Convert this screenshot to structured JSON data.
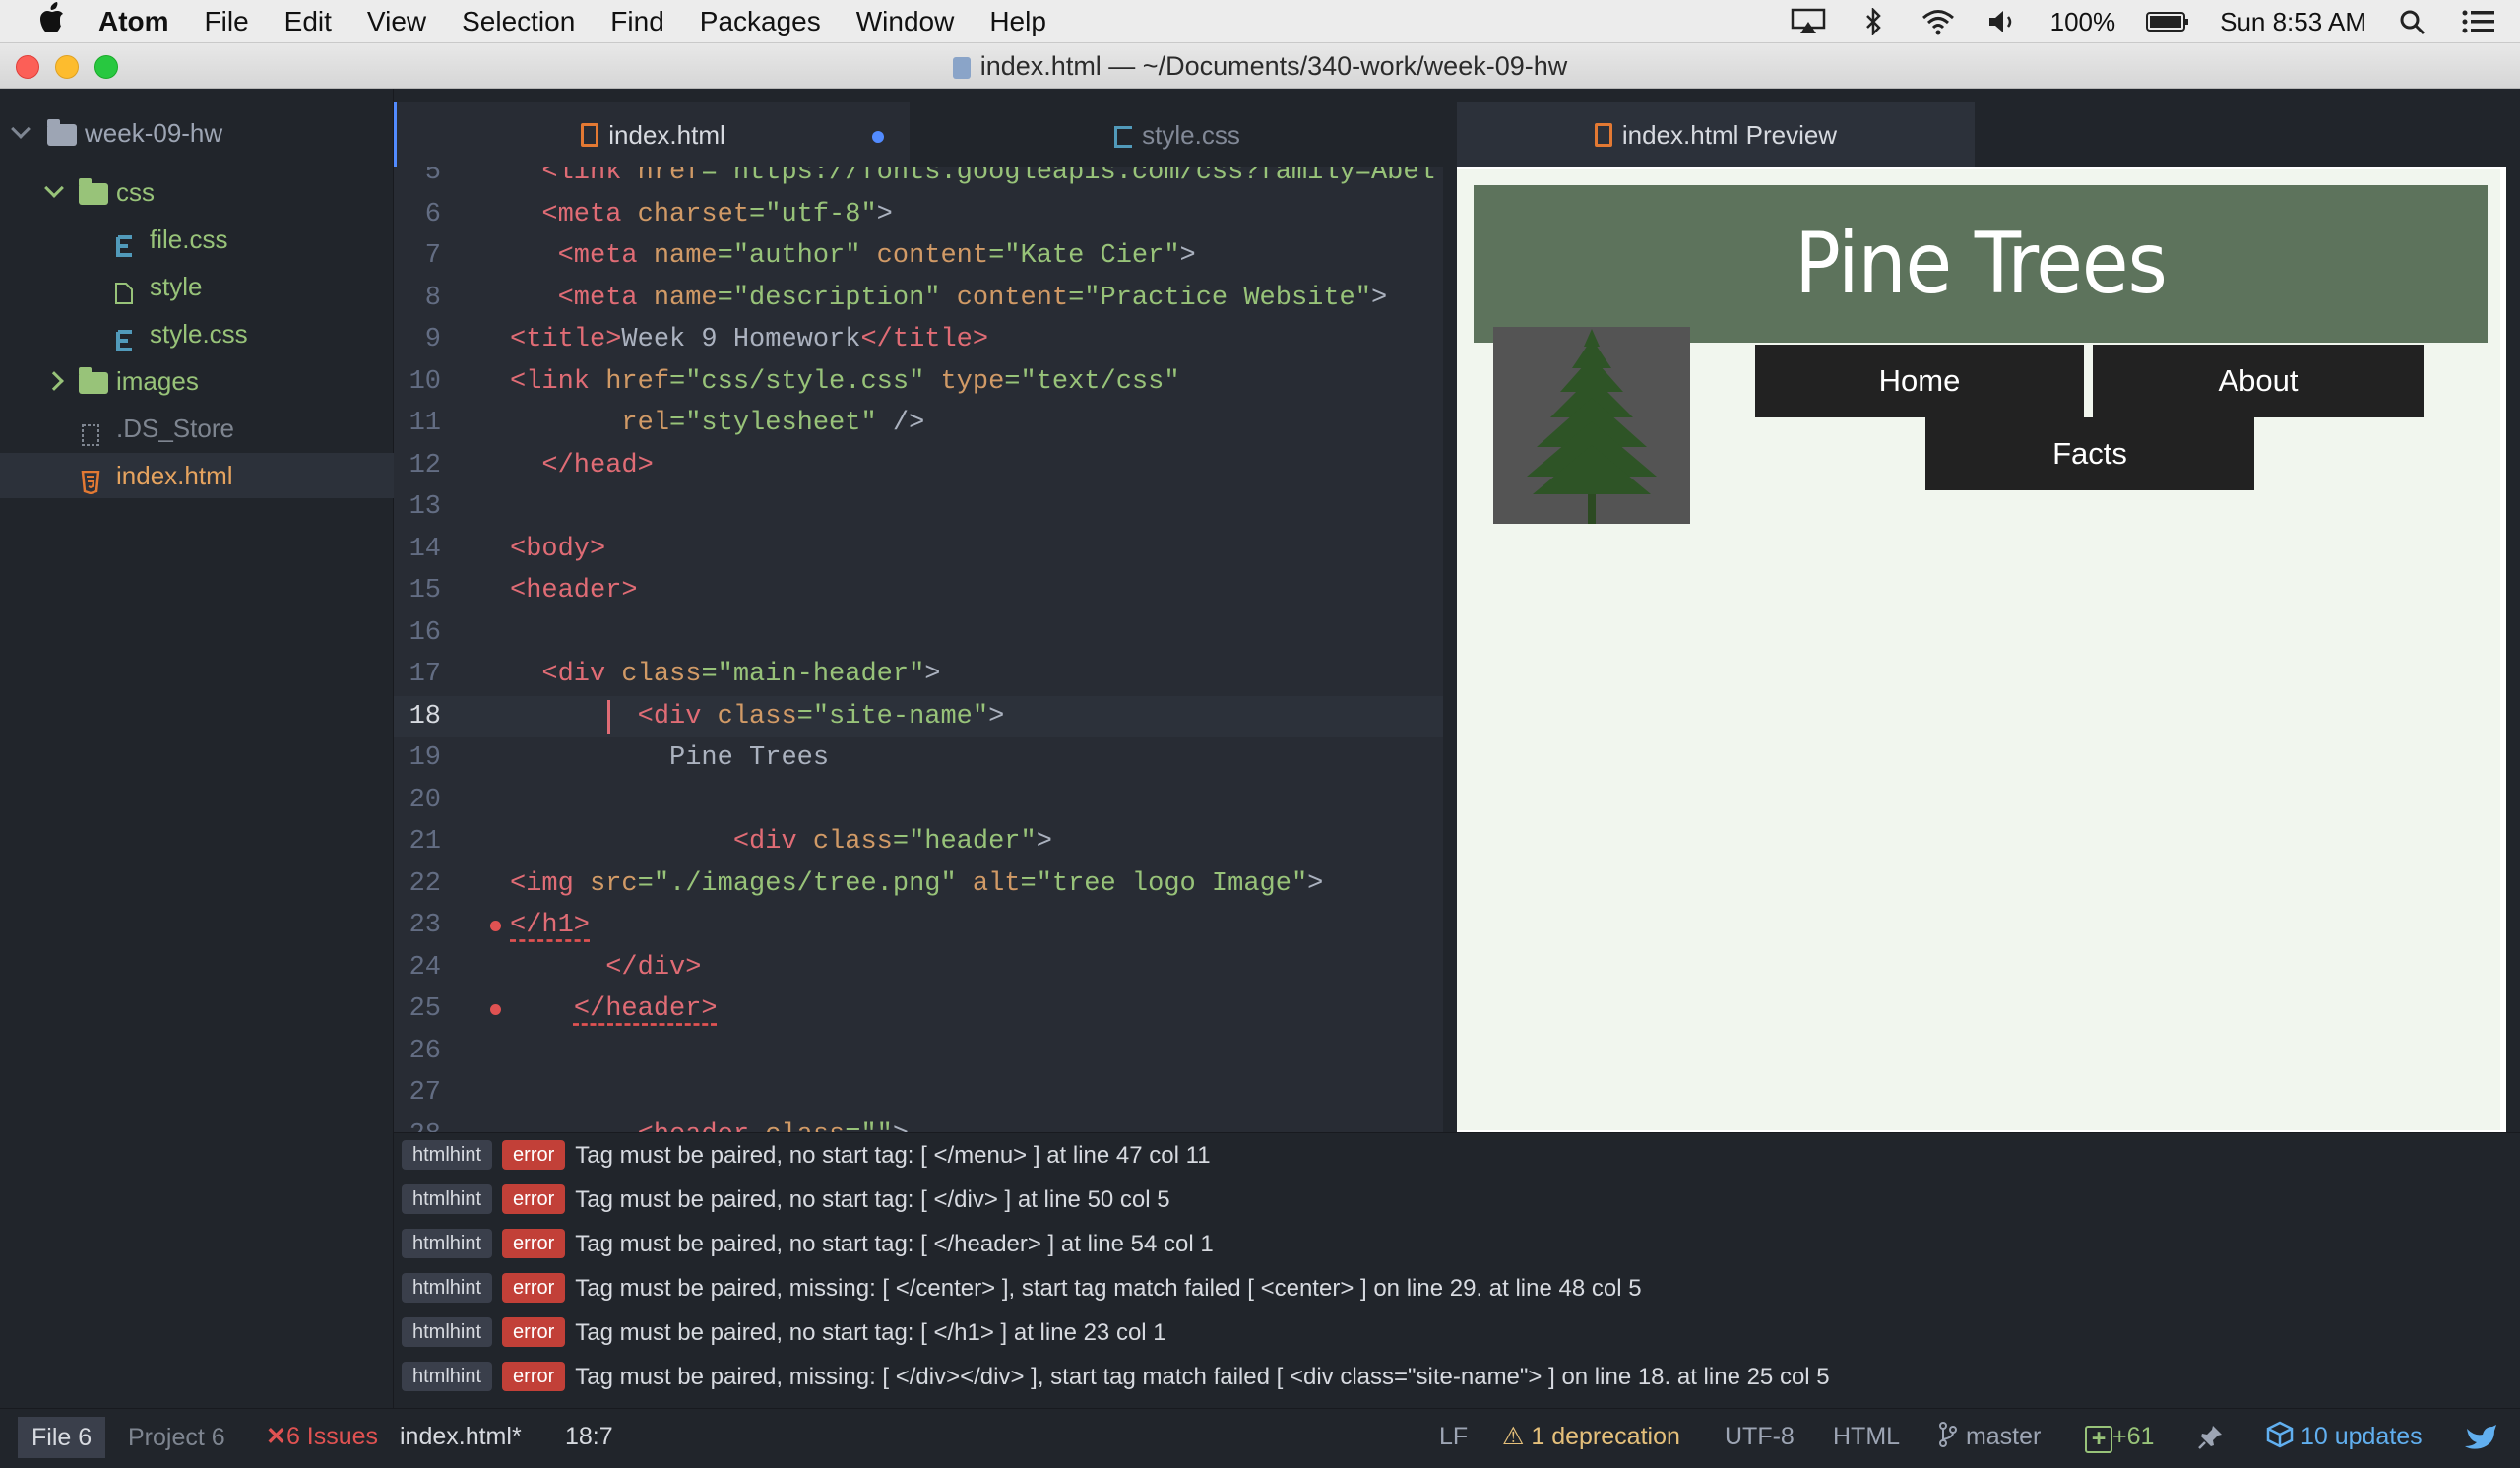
{
  "menubar": {
    "items": [
      "Atom",
      "File",
      "Edit",
      "View",
      "Selection",
      "Find",
      "Packages",
      "Window",
      "Help"
    ],
    "battery": "100%",
    "clock": "Sun 8:53 AM"
  },
  "window": {
    "title": "index.html — ~/Documents/340-work/week-09-hw"
  },
  "tree": {
    "root": "week-09-hw",
    "items": [
      {
        "label": "css",
        "kind": "folder",
        "expanded": true
      },
      {
        "label": "file.css",
        "kind": "css"
      },
      {
        "label": "style",
        "kind": "file"
      },
      {
        "label": "style.css",
        "kind": "css"
      },
      {
        "label": "images",
        "kind": "folder",
        "expanded": false
      },
      {
        "label": ".DS_Store",
        "kind": "file"
      },
      {
        "label": "index.html",
        "kind": "html",
        "selected": true
      }
    ]
  },
  "tabs": [
    {
      "label": "index.html",
      "active": true,
      "modified": true
    },
    {
      "label": "style.css",
      "active": false
    },
    {
      "label": "index.html Preview",
      "active": false
    }
  ],
  "editor": {
    "cursor_line": "18",
    "lines": [
      {
        "n": "5",
        "segs": [
          [
            "  ",
            "txt"
          ],
          [
            "<link ",
            "tag"
          ],
          [
            "href",
            "attr"
          ],
          [
            "=\"https://fonts.googleapis.com/css?family=Abel",
            "str"
          ]
        ]
      },
      {
        "n": "6",
        "segs": [
          [
            "  ",
            "txt"
          ],
          [
            "<meta ",
            "tag"
          ],
          [
            "charset",
            "attr"
          ],
          [
            "=\"utf-8\"",
            "str"
          ],
          [
            ">",
            "txt"
          ]
        ]
      },
      {
        "n": "7",
        "segs": [
          [
            "   ",
            "txt"
          ],
          [
            "<meta ",
            "tag"
          ],
          [
            "name",
            "attr"
          ],
          [
            "=\"author\" ",
            "str"
          ],
          [
            "content",
            "attr"
          ],
          [
            "=\"Kate Cier\"",
            "str"
          ],
          [
            ">",
            "txt"
          ]
        ]
      },
      {
        "n": "8",
        "segs": [
          [
            "   ",
            "txt"
          ],
          [
            "<meta ",
            "tag"
          ],
          [
            "name",
            "attr"
          ],
          [
            "=\"description\" ",
            "str"
          ],
          [
            "content",
            "attr"
          ],
          [
            "=\"Practice Website\"",
            "str"
          ],
          [
            ">",
            "txt"
          ]
        ]
      },
      {
        "n": "9",
        "segs": [
          [
            "<title>",
            "tag"
          ],
          [
            "Week 9 Homework",
            "txt"
          ],
          [
            "</title>",
            "tag"
          ]
        ]
      },
      {
        "n": "10",
        "segs": [
          [
            "<link ",
            "tag"
          ],
          [
            "href",
            "attr"
          ],
          [
            "=\"css/style.css\" ",
            "str"
          ],
          [
            "type",
            "attr"
          ],
          [
            "=\"text/css\"",
            "str"
          ]
        ]
      },
      {
        "n": "11",
        "segs": [
          [
            "       ",
            "txt"
          ],
          [
            "rel",
            "attr"
          ],
          [
            "=\"stylesheet\"",
            "str"
          ],
          [
            " />",
            "txt"
          ]
        ]
      },
      {
        "n": "12",
        "segs": [
          [
            "  ",
            "txt"
          ],
          [
            "</head>",
            "tag"
          ]
        ]
      },
      {
        "n": "13",
        "segs": []
      },
      {
        "n": "14",
        "segs": [
          [
            "<body>",
            "tag"
          ]
        ]
      },
      {
        "n": "15",
        "segs": [
          [
            "<header>",
            "tag"
          ]
        ]
      },
      {
        "n": "16",
        "segs": []
      },
      {
        "n": "17",
        "segs": [
          [
            "  ",
            "txt"
          ],
          [
            "<div ",
            "tag"
          ],
          [
            "class",
            "attr"
          ],
          [
            "=\"main-header\"",
            "str"
          ],
          [
            ">",
            "txt"
          ]
        ]
      },
      {
        "n": "18",
        "segs": [
          [
            "        ",
            "txt"
          ],
          [
            "<div ",
            "tag"
          ],
          [
            "class",
            "attr"
          ],
          [
            "=\"site-name\"",
            "str"
          ],
          [
            ">",
            "txt"
          ]
        ]
      },
      {
        "n": "19",
        "segs": [
          [
            "          ",
            "txt"
          ],
          [
            "Pine Trees",
            "txt"
          ]
        ]
      },
      {
        "n": "20",
        "segs": []
      },
      {
        "n": "21",
        "segs": [
          [
            "              ",
            "txt"
          ],
          [
            "<div ",
            "tag"
          ],
          [
            "class",
            "attr"
          ],
          [
            "=\"header\"",
            "str"
          ],
          [
            ">",
            "txt"
          ]
        ]
      },
      {
        "n": "22",
        "segs": [
          [
            "<img ",
            "tag"
          ],
          [
            "src",
            "attr"
          ],
          [
            "=\"./images/tree.png\" ",
            "str"
          ],
          [
            "alt",
            "attr"
          ],
          [
            "=\"tree logo Image\"",
            "str"
          ],
          [
            ">",
            "txt"
          ]
        ]
      },
      {
        "n": "23",
        "error": true,
        "segs": [
          [
            "</h1>",
            "tag-err"
          ]
        ]
      },
      {
        "n": "24",
        "segs": [
          [
            "      ",
            "txt"
          ],
          [
            "</div>",
            "tag"
          ]
        ]
      },
      {
        "n": "25",
        "error": true,
        "segs": [
          [
            "    ",
            "txt"
          ],
          [
            "</header>",
            "tag-err"
          ]
        ]
      },
      {
        "n": "26",
        "segs": []
      },
      {
        "n": "27",
        "segs": []
      },
      {
        "n": "28",
        "segs": [
          [
            "        ",
            "txt"
          ],
          [
            "<header ",
            "tag"
          ],
          [
            "class",
            "attr"
          ],
          [
            "=\"\"",
            "str"
          ],
          [
            ">",
            "txt"
          ]
        ]
      }
    ]
  },
  "preview": {
    "site_title": "Pine Trees",
    "nav": [
      "Home",
      "About",
      "Facts"
    ],
    "colors": {
      "header": "#5d735c",
      "nav": "#222222",
      "background": "#f1f6ee"
    }
  },
  "linter": {
    "messages": [
      {
        "provider": "htmlhint",
        "severity": "error",
        "text": "Tag must be paired, no start tag: [ </menu> ]",
        "loc": "at line 47 col 11"
      },
      {
        "provider": "htmlhint",
        "severity": "error",
        "text": "Tag must be paired, no start tag: [ </div> ]",
        "loc": "at line 50 col 5"
      },
      {
        "provider": "htmlhint",
        "severity": "error",
        "text": "Tag must be paired, no start tag: [ </header> ]",
        "loc": "at line 54 col 1"
      },
      {
        "provider": "htmlhint",
        "severity": "error",
        "text": "Tag must be paired, missing: [ </center> ], start tag match failed [ <center> ] on line 29.",
        "loc": "at line 48 col 5"
      },
      {
        "provider": "htmlhint",
        "severity": "error",
        "text": "Tag must be paired, no start tag: [ </h1> ]",
        "loc": "at line 23 col 1"
      },
      {
        "provider": "htmlhint",
        "severity": "error",
        "text": "Tag must be paired, missing: [ </div></div> ], start tag match failed [ <div class=\"site-name\"> ] on line 18.",
        "loc": "at line 25 col 5"
      }
    ]
  },
  "statusbar": {
    "file_tab": "File",
    "file_count": "6",
    "project_tab": "Project",
    "project_count": "6",
    "issues": "6 Issues",
    "filename": "index.html*",
    "cursor_pos": "18:7",
    "line_ending": "LF",
    "deprecation": "1 deprecation",
    "encoding": "UTF-8",
    "grammar": "HTML",
    "branch": "master",
    "git_added": "+61",
    "updates": "10 updates"
  }
}
